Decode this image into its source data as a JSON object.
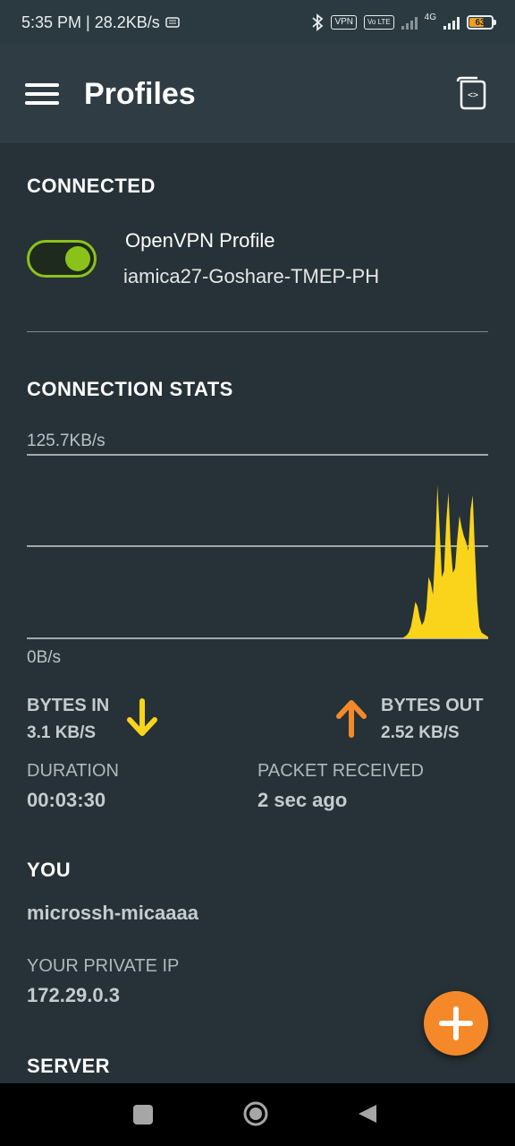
{
  "status_bar": {
    "time_speed": "5:35 PM | 28.2KB/s",
    "vpn_badge": "VPN",
    "volte_badge": "Vo LTE",
    "network": "4G",
    "battery": "63",
    "icons": [
      "hd-icon",
      "bluetooth-icon",
      "signal-icon",
      "battery-icon"
    ]
  },
  "app_bar": {
    "title": "Profiles",
    "icons": [
      "menu-icon",
      "import-profile-icon"
    ]
  },
  "connected": {
    "section_title": "CONNECTED",
    "toggle_on": true,
    "profile_name": "OpenVPN Profile",
    "profile_server": "iamica27-Goshare-TMEP-PH"
  },
  "connection_stats": {
    "section_title": "CONNECTION STATS",
    "max_label": "125.7KB/s",
    "min_label": "0B/s",
    "bytes_in_label": "BYTES IN",
    "bytes_in_value": "3.1 KB/S",
    "bytes_out_label": "BYTES OUT",
    "bytes_out_value": "2.52 KB/S",
    "duration_label": "DURATION",
    "duration_value": "00:03:30",
    "packet_label": "PACKET RECEIVED",
    "packet_value": "2 sec ago"
  },
  "chart_data": {
    "type": "area",
    "ylim": [
      0,
      125.7
    ],
    "unit": "KB/s",
    "values": [
      0,
      0,
      0,
      0,
      0,
      0,
      0,
      0,
      0,
      0,
      0,
      0,
      0,
      0,
      0,
      0,
      0,
      0,
      0,
      0,
      0,
      0,
      0,
      0,
      0,
      0,
      0,
      0,
      0,
      0,
      0,
      0,
      0,
      0,
      0,
      0,
      0,
      0,
      0,
      0,
      0,
      0,
      0,
      0,
      0,
      0,
      0,
      0,
      0,
      0,
      0,
      0,
      0,
      0,
      0,
      0,
      0,
      0,
      0,
      0,
      0,
      0,
      0,
      0,
      0,
      0,
      0,
      0,
      0,
      0,
      0,
      0,
      0,
      0,
      0,
      0,
      0,
      0,
      0,
      0,
      0,
      0,
      0,
      0,
      0,
      0,
      0,
      0,
      0,
      0,
      0,
      0,
      0,
      0,
      0,
      0,
      0,
      0,
      0,
      0,
      0,
      0,
      0,
      0,
      0,
      0,
      0,
      0,
      0,
      0,
      0,
      0,
      0,
      0,
      0,
      0,
      0,
      0,
      0,
      0,
      0,
      0,
      0,
      0,
      0,
      0,
      0,
      0,
      0,
      0,
      0,
      0,
      0,
      0,
      0,
      0,
      0,
      0,
      0,
      0,
      0,
      0,
      0,
      0,
      0,
      0,
      0,
      0,
      0,
      0,
      0,
      0,
      0,
      0,
      0,
      0,
      0,
      0,
      0,
      0,
      0,
      0,
      0,
      0,
      0,
      0,
      0,
      0,
      0,
      0,
      0,
      1,
      2,
      4,
      8,
      16,
      25,
      22,
      14,
      9,
      12,
      20,
      42,
      38,
      30,
      60,
      105,
      75,
      42,
      46,
      80,
      100,
      64,
      45,
      48,
      68,
      84,
      76,
      70,
      66,
      60,
      88,
      98,
      60,
      26,
      8,
      4,
      3,
      2,
      1
    ]
  },
  "you": {
    "section_title": "YOU",
    "username": "microssh-micaaaa",
    "private_ip_label": "YOUR PRIVATE IP",
    "private_ip_value": "172.29.0.3"
  },
  "server": {
    "section_title": "SERVER"
  },
  "colors": {
    "background": "#263238",
    "app_bar": "#2f3c43",
    "toggle_accent": "#8bc21a",
    "chart_fill": "#f9d41a",
    "bytes_in_arrow": "#f9d41a",
    "bytes_out_arrow": "#f5892a",
    "fab": "#f5892a"
  }
}
